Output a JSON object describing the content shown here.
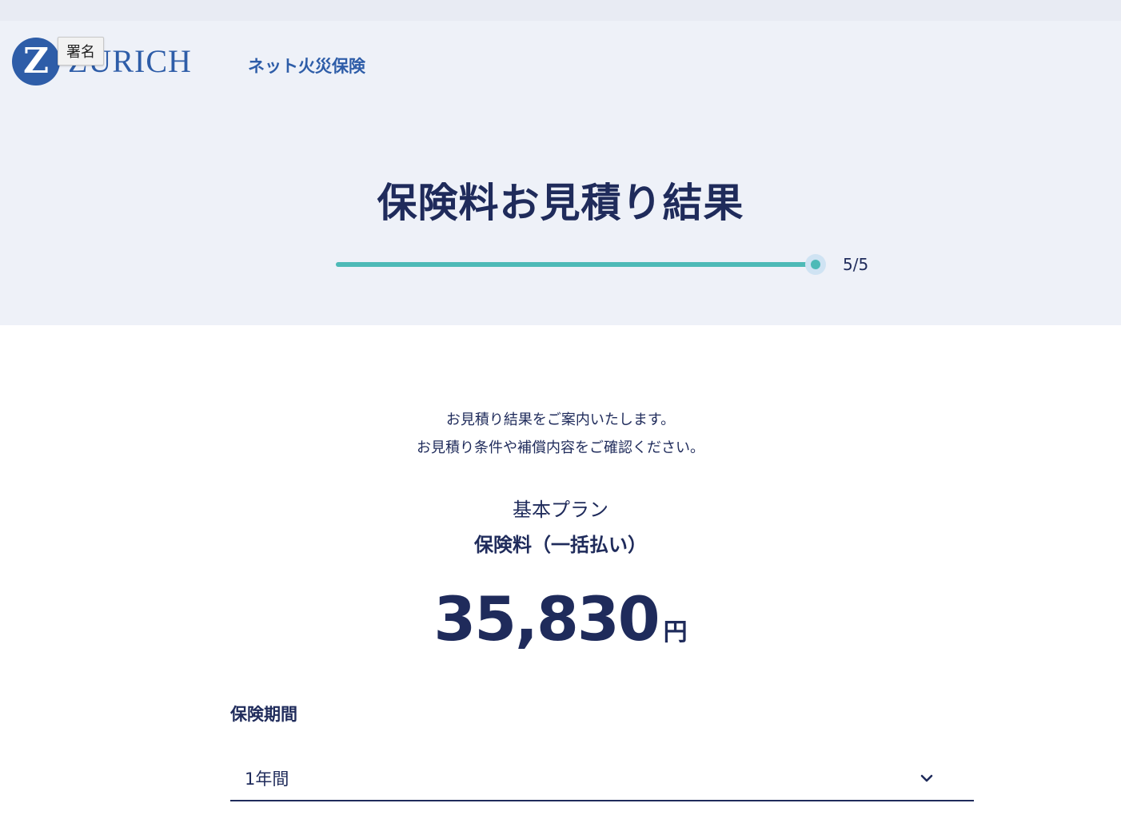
{
  "header": {
    "logo_letter": "Z",
    "logo_word": "ZURICH",
    "tooltip": "署名",
    "service_name": "ネット火災保険"
  },
  "hero": {
    "title": "保険料お見積り結果",
    "progress": {
      "current": 5,
      "total": 5,
      "label": "5/5"
    }
  },
  "result": {
    "intro_line_1": "お見積り結果をご案内いたします。",
    "intro_line_2": "お見積り条件や補償内容をご確認ください。",
    "plan_name": "基本プラン",
    "premium_label": "保険料（一括払い）",
    "premium_value": "35,830",
    "premium_unit": "円"
  },
  "period": {
    "label": "保険期間",
    "selected": "1年間"
  },
  "colors": {
    "brand_blue": "#2e5da8",
    "navy_text": "#1f2b5b",
    "teal_accent": "#4dbab7",
    "hero_bg": "#eef1f8"
  },
  "icons": {
    "select_toggle": "chevron-down-icon"
  }
}
